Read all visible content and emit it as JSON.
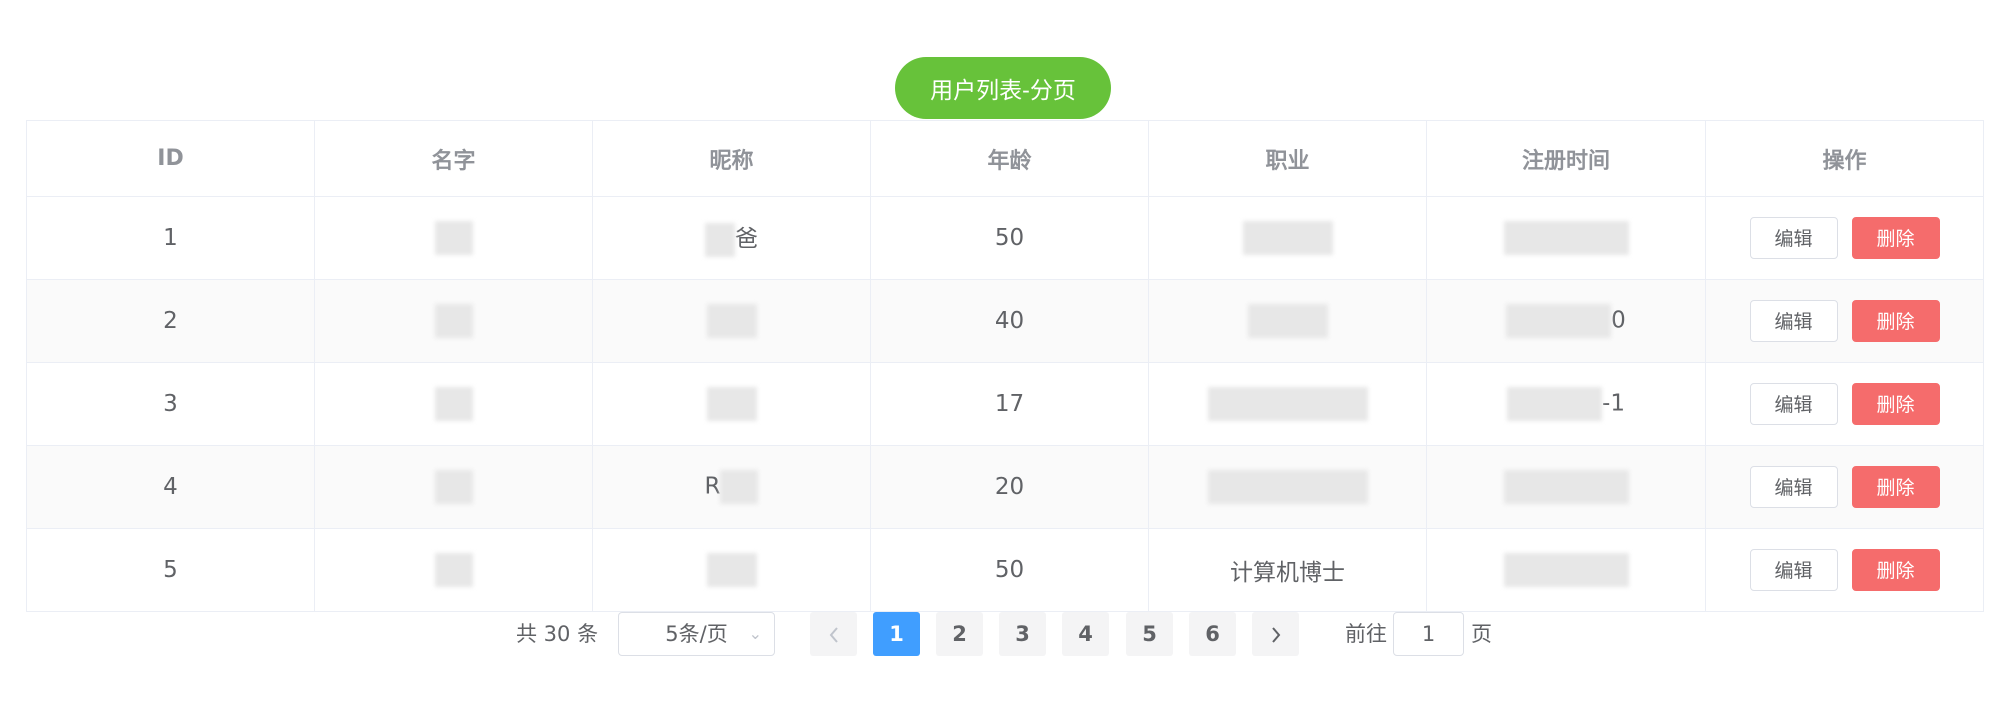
{
  "header": {
    "title_button": "用户列表-分页"
  },
  "table": {
    "columns": [
      "ID",
      "名字",
      "昵称",
      "年龄",
      "职业",
      "注册时间",
      "操作"
    ],
    "rows": [
      {
        "id": "1",
        "nickname_visible": "爸",
        "age": "50",
        "job": "",
        "time_visible": "",
        "edit": "编辑",
        "delete": "删除"
      },
      {
        "id": "2",
        "nickname_visible": "",
        "age": "40",
        "job": "",
        "time_visible": "0",
        "edit": "编辑",
        "delete": "删除"
      },
      {
        "id": "3",
        "nickname_visible": "",
        "age": "17",
        "job": "",
        "time_visible": "-1",
        "edit": "编辑",
        "delete": "删除"
      },
      {
        "id": "4",
        "nickname_visible": "R",
        "age": "20",
        "job": "",
        "time_visible": "",
        "edit": "编辑",
        "delete": "删除"
      },
      {
        "id": "5",
        "nickname_visible": "",
        "age": "50",
        "job": "计算机博士",
        "time_visible": "",
        "edit": "编辑",
        "delete": "删除"
      }
    ]
  },
  "pagination": {
    "total": "共 30 条",
    "page_size": "5条/页",
    "prev_icon": "chevron-left-icon",
    "next_icon": "chevron-right-icon",
    "pages": [
      "1",
      "2",
      "3",
      "4",
      "5",
      "6"
    ],
    "current_page": "1",
    "goto_prefix": "前往",
    "goto_value": "1",
    "goto_suffix": "页"
  },
  "colors": {
    "title_green": "#67c23a",
    "delete_red": "#f56c6c",
    "active_blue": "#409eff",
    "border": "#ebeef5"
  }
}
